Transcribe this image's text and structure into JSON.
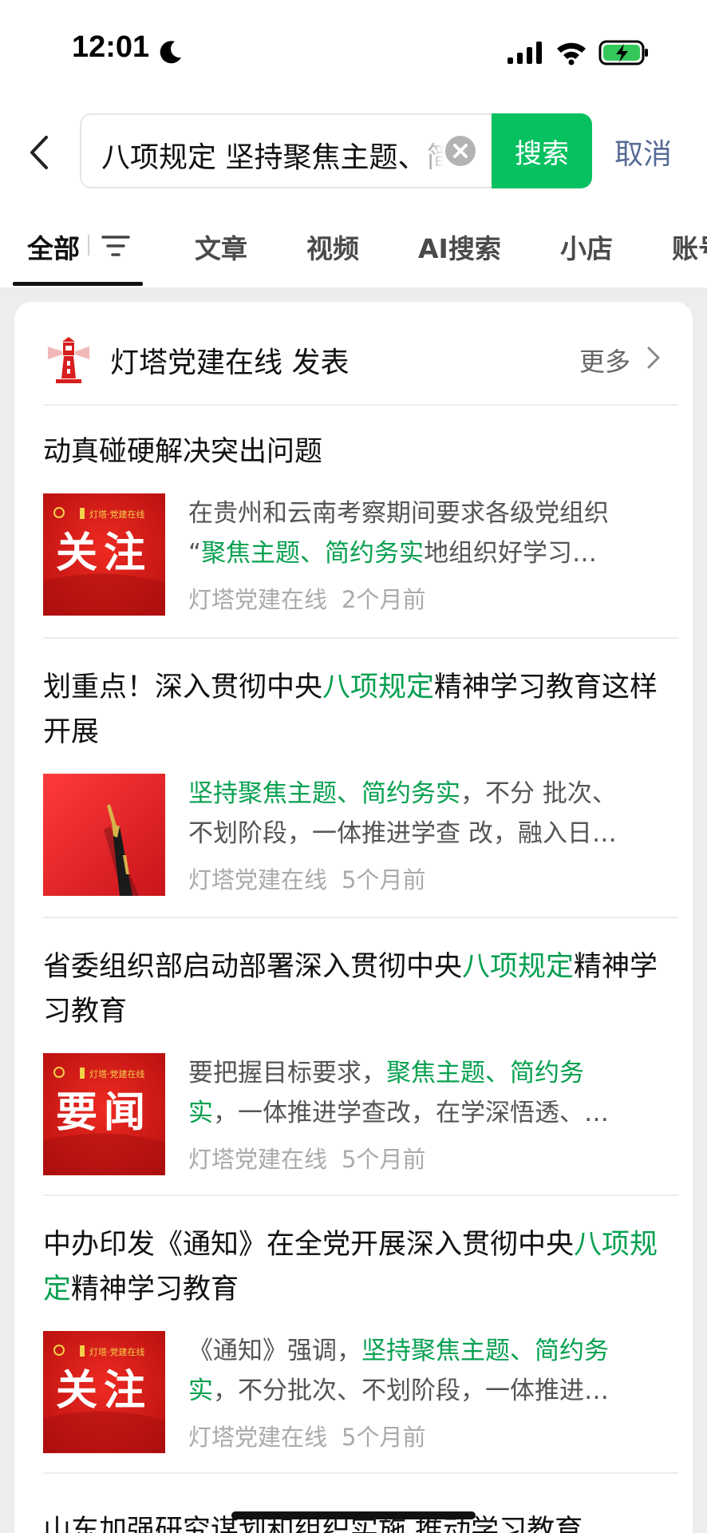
{
  "status_bar": {
    "time": "12:01"
  },
  "search": {
    "query": "八项规定 坚持聚焦主题、简约务实",
    "button_label": "搜索",
    "cancel_label": "取消"
  },
  "tabs": [
    {
      "label": "全部",
      "active": true
    },
    {
      "label": "文章"
    },
    {
      "label": "视频"
    },
    {
      "label": "AI搜索"
    },
    {
      "label": "小店"
    },
    {
      "label": "账号"
    }
  ],
  "account": {
    "name": "灯塔党建在线 发表",
    "more_label": "更多"
  },
  "articles": [
    {
      "title_parts": [
        {
          "text": "动真碰硬解决突出问题"
        }
      ],
      "thumb_type": "关注",
      "thumb_text": "关注",
      "thumb_brand": "灯塔·党建在线",
      "snippet_lines": [
        [
          {
            "text": "在贵州和云南考察期间要求各级党组织"
          }
        ],
        [
          {
            "text": "“"
          },
          {
            "text": "聚焦主题、简约务实",
            "hl": true
          },
          {
            "text": "地组织好学习…"
          }
        ]
      ],
      "source": "灯塔党建在线",
      "time": "2个月前"
    },
    {
      "title_parts": [
        {
          "text": "划重点！深入贯彻中央"
        },
        {
          "text": "八项规定",
          "hl": true
        },
        {
          "text": "精神学习教育这样开展"
        }
      ],
      "thumb_type": "pen",
      "snippet_lines": [
        [
          {
            "text": "坚持聚焦主题、简约务实",
            "hl": true
          },
          {
            "text": "，不分 批次、"
          }
        ],
        [
          {
            "text": "不划阶段，一体推进学查 改，融入日…"
          }
        ]
      ],
      "source": "灯塔党建在线",
      "time": "5个月前"
    },
    {
      "title_parts": [
        {
          "text": "省委组织部启动部署深入贯彻中央"
        },
        {
          "text": "八项规定",
          "hl": true
        },
        {
          "text": "精神学习教育"
        }
      ],
      "thumb_type": "要闻",
      "thumb_text": "要闻",
      "thumb_brand": "灯塔·党建在线",
      "snippet_lines": [
        [
          {
            "text": "要把握目标要求，"
          },
          {
            "text": "聚焦主题、简约务",
            "hl": true
          }
        ],
        [
          {
            "text": "实",
            "hl": true
          },
          {
            "text": "，一体推进学查改，在学深悟透、…"
          }
        ]
      ],
      "source": "灯塔党建在线",
      "time": "5个月前"
    },
    {
      "title_parts": [
        {
          "text": "中办印发《通知》在全党开展深入贯彻中央"
        },
        {
          "text": "八项规定",
          "hl": true
        },
        {
          "text": "精神学习教育"
        }
      ],
      "thumb_type": "关注",
      "thumb_text": "关注",
      "thumb_brand": "灯塔·党建在线",
      "snippet_lines": [
        [
          {
            "text": "《通知》强调，"
          },
          {
            "text": "坚持聚焦主题、简约务",
            "hl": true
          }
        ],
        [
          {
            "text": "实",
            "hl": true
          },
          {
            "text": "，不分批次、不划阶段，一体推进…"
          }
        ]
      ],
      "source": "灯塔党建在线",
      "time": "5个月前"
    }
  ],
  "partial_title": "山东加强研究谋划和组织实施 推动学习教育",
  "colors": {
    "accent": "#07c160",
    "highlight": "#07a050",
    "link": "#576b95",
    "thumb_red": "#d81e1e"
  }
}
